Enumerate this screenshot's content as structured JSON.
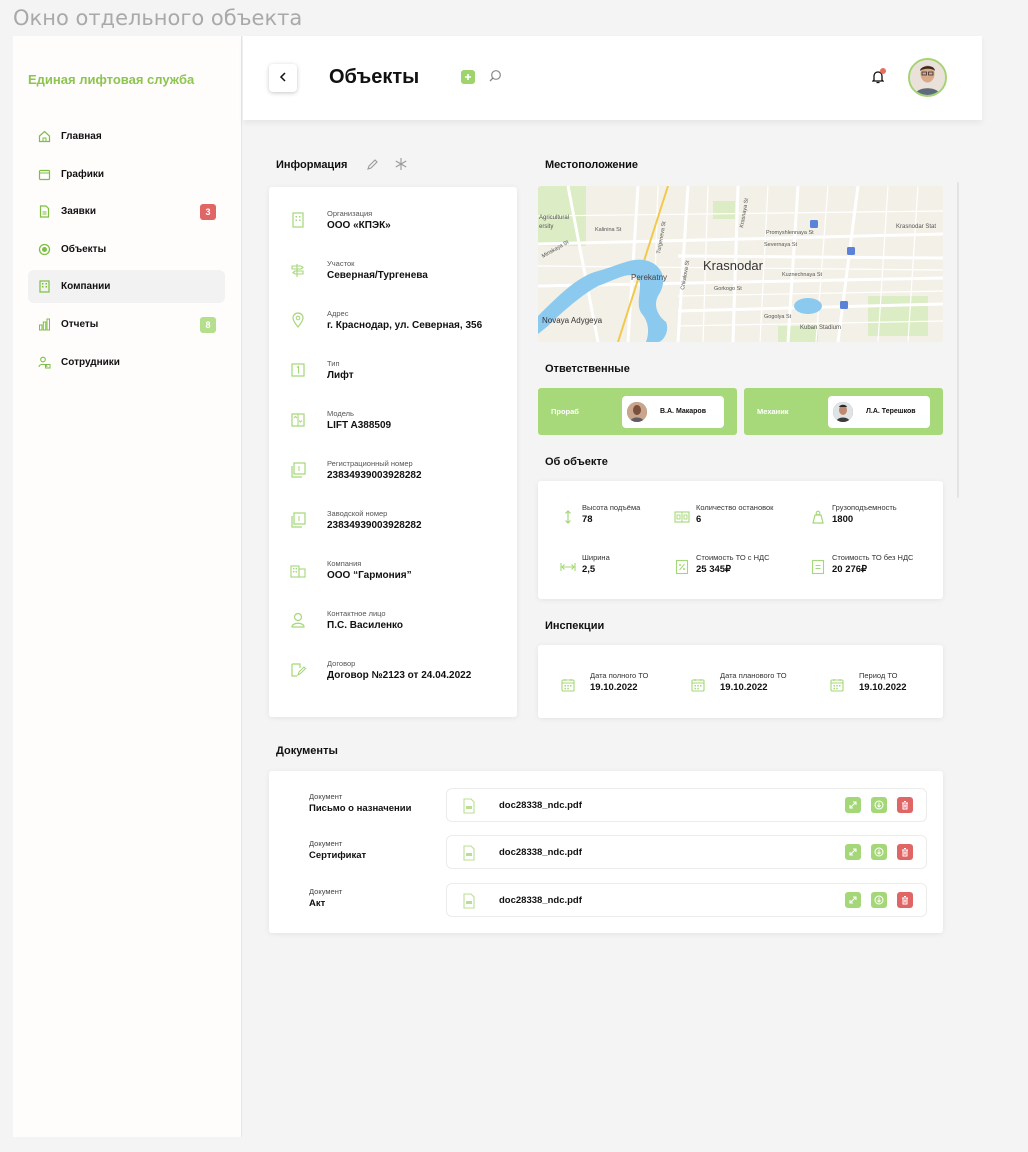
{
  "frame_title": "Окно отдельного объекта",
  "brand": "Единая лифтовая служба",
  "sidebar": {
    "items": [
      {
        "label": "Главная",
        "icon": "home-icon"
      },
      {
        "label": "Графики",
        "icon": "calendar-icon"
      },
      {
        "label": "Заявки",
        "icon": "document-icon",
        "badge": "3"
      },
      {
        "label": "Объекты",
        "icon": "target-icon"
      },
      {
        "label": "Компании",
        "icon": "building-icon",
        "active": true
      },
      {
        "label": "Отчеты",
        "icon": "bar-chart-icon",
        "badge": "8"
      },
      {
        "label": "Сотрудники",
        "icon": "users-icon"
      }
    ]
  },
  "header": {
    "title": "Объекты"
  },
  "info": {
    "title": "Информация",
    "rows": [
      {
        "label": "Организация",
        "value": "ООО «КПЭК»"
      },
      {
        "label": "Участок",
        "value": "Северная/Тургенева"
      },
      {
        "label": "Адрес",
        "value": "г. Краснодар, ул. Северная, 356"
      },
      {
        "label": "Тип",
        "value": "Лифт"
      },
      {
        "label": "Модель",
        "value": "LIFT A388509"
      },
      {
        "label": "Регистрационный номер",
        "value": "23834939003928282"
      },
      {
        "label": "Заводской номер",
        "value": "23834939003928282"
      },
      {
        "label": "Компания",
        "value": "ООО “Гармония”"
      },
      {
        "label": "Контактное лицо",
        "value": "П.С. Василенко"
      },
      {
        "label": "Договор",
        "value": "Договор №2123 от 24.04.2022"
      }
    ]
  },
  "location": {
    "title": "Местоположение",
    "map_labels": {
      "city": "Krasnodar",
      "district1": "Perekatny",
      "district2": "Novaya Adygeya",
      "stadium": "Kuban Stadium",
      "street1": "Krasnaya St",
      "street2": "Severnaya St",
      "street3": "Kuznechnaya St",
      "street4": "Promyshlennaya St",
      "street5": "Kalinina St",
      "street6": "Minskaya St",
      "street7": "Gorkogo St",
      "street8": "Gogolya St",
      "street9": "Chkalova St",
      "street10": "Turgeneva St",
      "area1": "Agricultural",
      "area2": "ersity",
      "station": "Krasnodar Stat"
    }
  },
  "responsible": {
    "title": "Ответственные",
    "people": [
      {
        "role": "Прораб",
        "name": "В.А. Макаров"
      },
      {
        "role": "Механик",
        "name": "Л.А. Терешков"
      }
    ]
  },
  "about": {
    "title": "Об объекте",
    "cells": [
      {
        "label": "Высота подъёма",
        "value": "78"
      },
      {
        "label": "Количество остановок",
        "value": "6"
      },
      {
        "label": "Грузоподъемность",
        "value": "1800"
      },
      {
        "label": "Ширина",
        "value": "2,5"
      },
      {
        "label": "Стоимость ТО с НДС",
        "value": "25 345₽"
      },
      {
        "label": "Стоимость ТО без НДС",
        "value": "20 276₽"
      }
    ]
  },
  "inspections": {
    "title": "Инспекции",
    "cells": [
      {
        "label": "Дата полного ТО",
        "value": "19.10.2022"
      },
      {
        "label": "Дата планового ТО",
        "value": "19.10.2022"
      },
      {
        "label": "Период ТО",
        "value": "19.10.2022"
      }
    ]
  },
  "documents": {
    "title": "Документы",
    "items": [
      {
        "label": "Документ",
        "value": "Письмо о назначении",
        "file": "doc28338_ndc.pdf"
      },
      {
        "label": "Документ",
        "value": "Сертификат",
        "file": "doc28338_ndc.pdf"
      },
      {
        "label": "Документ",
        "value": "Акт",
        "file": "doc28338_ndc.pdf"
      }
    ]
  },
  "colors": {
    "accent": "#8cc54f",
    "accent_light": "#a7d87a",
    "danger": "#e06565"
  }
}
